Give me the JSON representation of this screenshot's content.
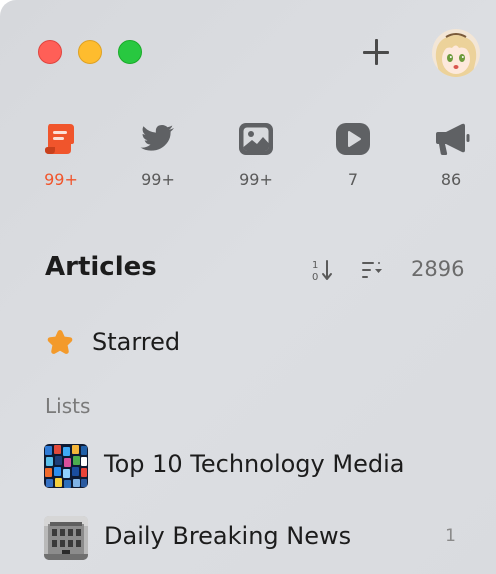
{
  "colors": {
    "accent": "#f0552c",
    "starred": "#f39a2b",
    "text_primary": "#1c1c1c",
    "text_secondary": "#6b6b6b"
  },
  "window_controls": [
    "close",
    "minimize",
    "maximize"
  ],
  "toolbar": {
    "add_icon": "plus-icon",
    "avatar_icon": "user-avatar"
  },
  "feed_types": [
    {
      "icon": "article-icon",
      "count": "99+",
      "active": true
    },
    {
      "icon": "twitter-icon",
      "count": "99+",
      "active": false
    },
    {
      "icon": "picture-icon",
      "count": "99+",
      "active": false
    },
    {
      "icon": "video-icon",
      "count": "7",
      "active": false
    },
    {
      "icon": "megaphone-icon",
      "count": "86",
      "active": false
    }
  ],
  "section": {
    "title": "Articles",
    "sort_icon": "sort-icon",
    "filter_icon": "filter-list-icon",
    "count": "2896"
  },
  "starred": {
    "icon": "star-icon",
    "label": "Starred"
  },
  "lists": {
    "header": "Lists",
    "items": [
      {
        "label": "Top 10 Technology Media",
        "badge": ""
      },
      {
        "label": "Daily Breaking News",
        "badge": "1"
      }
    ]
  }
}
